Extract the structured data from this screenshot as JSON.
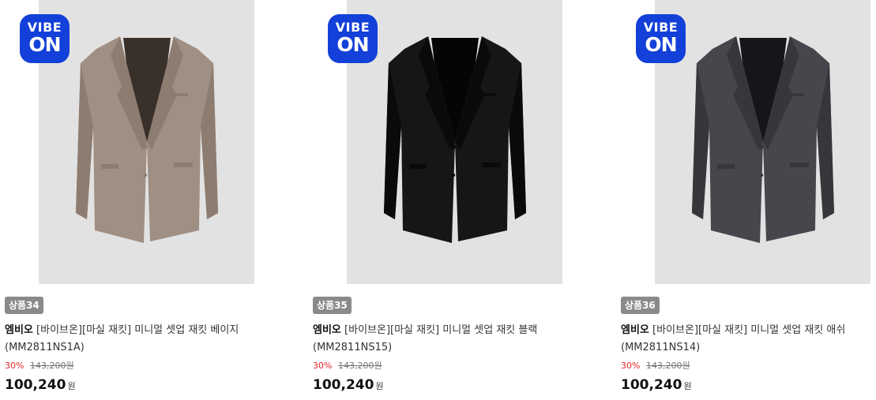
{
  "products": [
    {
      "badge": {
        "line1": "VIBE",
        "line2": "ON"
      },
      "tag": "상품34",
      "brand": "엠비오",
      "name": "[바이브온][마실 재킷] 미니멀 셋업 재킷 베이지",
      "code": "(MM2811NS1A)",
      "discount": "30%",
      "original_price": "143,200원",
      "price": "100,240",
      "currency": "원",
      "jacket_color": "#a08f83",
      "jacket_shade": "#8d7c70",
      "lining_color": "#3a302a"
    },
    {
      "badge": {
        "line1": "VIBE",
        "line2": "ON"
      },
      "tag": "상품35",
      "brand": "엠비오",
      "name": "[바이브온][마실 재킷] 미니멀 셋업 재킷 블랙",
      "code": "(MM2811NS15)",
      "discount": "30%",
      "original_price": "143,200원",
      "price": "100,240",
      "currency": "원",
      "jacket_color": "#161616",
      "jacket_shade": "#0a0a0a",
      "lining_color": "#050505"
    },
    {
      "badge": {
        "line1": "VIBE",
        "line2": "ON"
      },
      "tag": "상품36",
      "brand": "엠비오",
      "name": "[바이브온][마실 재킷] 미니멀 셋업 재킷 애쉬",
      "code": "(MM2811NS14)",
      "discount": "30%",
      "original_price": "143,200원",
      "price": "100,240",
      "currency": "원",
      "jacket_color": "#45474c",
      "jacket_shade": "#35373b",
      "lining_color": "#15161a"
    }
  ]
}
